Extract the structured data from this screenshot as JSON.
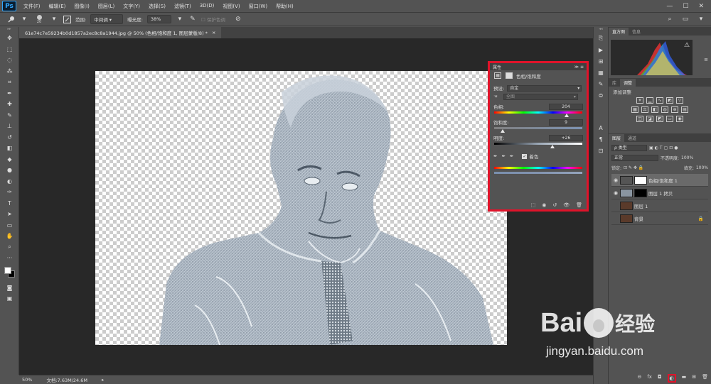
{
  "app": {
    "logo": "Ps"
  },
  "menu": [
    "文件(F)",
    "编辑(E)",
    "图像(I)",
    "图层(L)",
    "文字(Y)",
    "选择(S)",
    "滤镜(T)",
    "3D(D)",
    "视图(V)",
    "窗口(W)",
    "帮助(H)"
  ],
  "window_controls": [
    "—",
    "☐",
    "✕"
  ],
  "options_bar": {
    "brush_size": "20",
    "range_label": "范围:",
    "range_value": "中间调",
    "exposure_label": "曝光度:",
    "exposure_value": "38%",
    "protect_tones": "保护色调"
  },
  "tools": [
    "move-tool-icon",
    "marquee-tool-icon",
    "lasso-tool-icon",
    "quick-select-tool-icon",
    "crop-tool-icon",
    "eyedropper-tool-icon",
    "healing-tool-icon",
    "brush-tool-icon",
    "clone-stamp-tool-icon",
    "history-brush-tool-icon",
    "eraser-tool-icon",
    "paint-bucket-tool-icon",
    "blur-tool-icon",
    "dodge-tool-icon",
    "pen-tool-icon",
    "type-tool-icon",
    "path-select-tool-icon",
    "shape-tool-icon",
    "hand-tool-icon",
    "zoom-tool-icon",
    "more-tools-icon"
  ],
  "document_tab": {
    "title": "61e74c7e59234b0d1857a2ec8c8a1944.jpg @ 50% (色相/饱和度 1, 图层蒙版/8) *",
    "close": "×"
  },
  "status": {
    "zoom": "50%",
    "doc_info": "文档:7.63M/24.6M"
  },
  "properties_panel": {
    "title": "属性",
    "adjustment_name": "色相/饱和度",
    "preset_label": "预设:",
    "preset_value": "自定",
    "channel_value": "全图",
    "hue_label": "色相:",
    "hue_value": "204",
    "saturation_label": "饱和度:",
    "saturation_value": "9",
    "lightness_label": "明度:",
    "lightness_value": "+26",
    "colorize_label": "着色",
    "colorize_checked": true,
    "hue_fraction": 0.783,
    "saturation_fraction": 0.09,
    "lightness_fraction": 0.63
  },
  "histogram_panel": {
    "tabs": [
      "直方图",
      "信息"
    ]
  },
  "adjustments_panel": {
    "tabs": [
      "库",
      "调整"
    ],
    "add_label": "添加调整"
  },
  "layers_panel": {
    "tabs": [
      "图层",
      "通道"
    ],
    "filter_label": "ρ 类型",
    "blend_mode": "正常",
    "opacity_label": "不透明度:",
    "opacity_value": "100%",
    "lock_label": "锁定:",
    "fill_label": "填充:",
    "fill_value": "100%",
    "layers": [
      {
        "name": "色相/饱和度 1",
        "visible": true,
        "selected": true
      },
      {
        "name": "图层 1 拷贝",
        "visible": true,
        "selected": false
      },
      {
        "name": "图层 1",
        "visible": false,
        "selected": false
      },
      {
        "name": "背景",
        "visible": false,
        "selected": false
      }
    ],
    "footer_icons": [
      "link-icon",
      "fx-icon",
      "mask-icon",
      "adjustment-icon",
      "group-icon",
      "new-layer-icon",
      "trash-icon"
    ]
  },
  "watermark": {
    "brand": "Bai",
    "brand_cn": "经验",
    "url": "jingyan.baidu.com"
  },
  "colors": {
    "highlight": "#e0132a",
    "panel": "#535353",
    "canvas": "#282828"
  }
}
